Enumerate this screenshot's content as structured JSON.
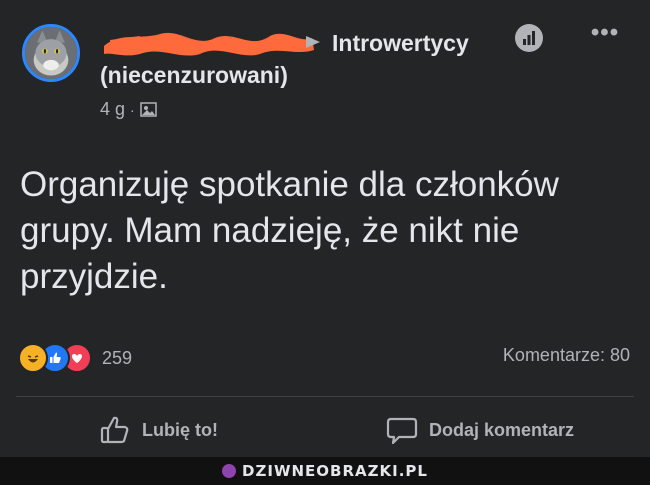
{
  "post": {
    "group_name": "Introwertycy",
    "group_subtitle": "(niecenzurowani)",
    "time": "4 g",
    "time_separator": "·",
    "text": "Organizuję spotkanie dla członków\ngrupy. Mam nadzieję, że nikt nie\nprzyjdzie.",
    "more_label": "•••"
  },
  "reactions": {
    "types": [
      "haha-icon",
      "like-icon",
      "love-icon"
    ],
    "count": "259"
  },
  "comments": {
    "count_label": "Komentarze: 80"
  },
  "actions": {
    "like_label": "Lubię to!",
    "comment_label": "Dodaj komentarz"
  },
  "watermark": {
    "text": "DZIWNEOBRAZKI.PL"
  },
  "colors": {
    "background": "#242526",
    "text": "#e4e6eb",
    "secondary_text": "#b0b3b8",
    "avatar_ring": "#2d88ff",
    "redaction": "#ff6a3d"
  }
}
